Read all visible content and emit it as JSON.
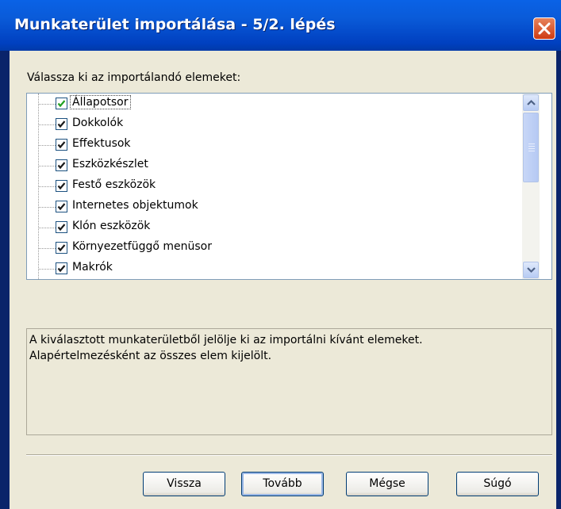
{
  "window": {
    "title": "Munkaterület importálása - 5/2. lépés",
    "close_icon": "close-icon"
  },
  "prompt": "Válassza ki az importálandó elemeket:",
  "items": [
    {
      "label": "Állapotsor",
      "checked": true,
      "selected": true
    },
    {
      "label": "Dokkolók",
      "checked": true
    },
    {
      "label": "Effektusok",
      "checked": true
    },
    {
      "label": "Eszközkészlet",
      "checked": true
    },
    {
      "label": "Festő eszközök",
      "checked": true
    },
    {
      "label": "Internetes objektumok",
      "checked": true
    },
    {
      "label": "Klón eszközök",
      "checked": true
    },
    {
      "label": "Környezetfüggő menüsor",
      "checked": true
    },
    {
      "label": "Makrók",
      "checked": true
    }
  ],
  "description": {
    "line1": "A kiválasztott munkaterületből jelölje ki az importálni kívánt elemeket.",
    "line2": "Alapértelmezésként az összes elem kijelölt."
  },
  "buttons": {
    "back": "Vissza",
    "next": "Tovább",
    "cancel": "Mégse",
    "help": "Súgó"
  },
  "colors": {
    "titlebar": "#0a5bd9",
    "dialog_bg": "#ece9d8",
    "close_button": "#d9542a"
  }
}
